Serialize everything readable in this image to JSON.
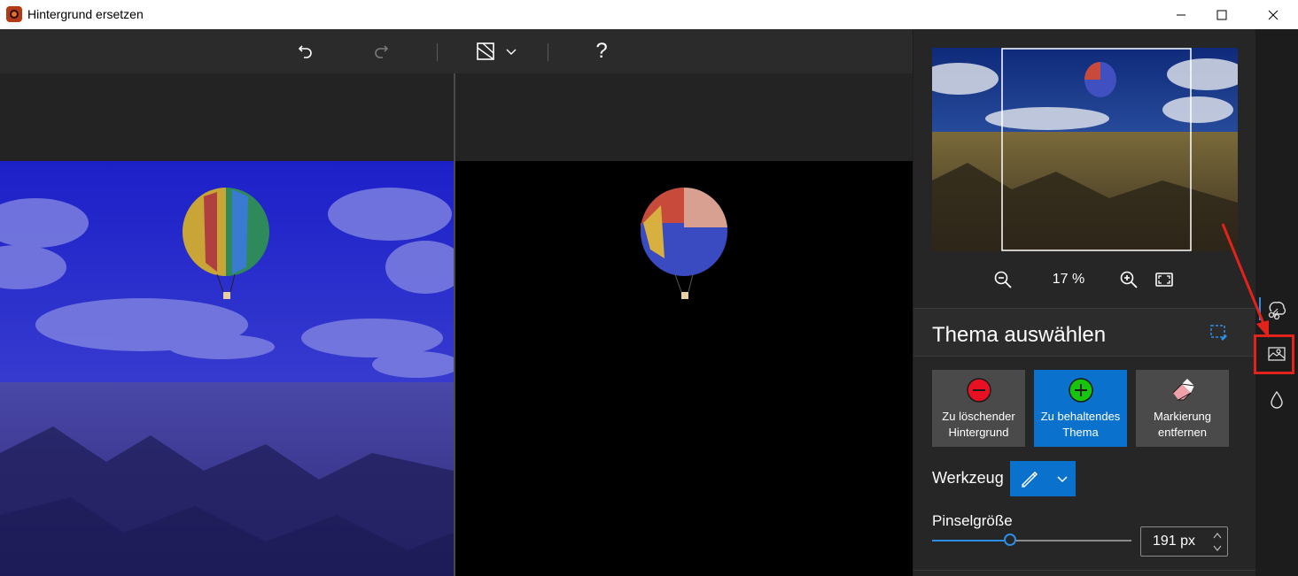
{
  "window": {
    "title": "Hintergrund ersetzen",
    "controls": [
      "minimize-icon",
      "maximize-icon",
      "close-icon"
    ]
  },
  "toolbar": {
    "icons": [
      "undo-icon",
      "redo-icon",
      "image-view-icon",
      "chevron-down-icon",
      "help-icon"
    ],
    "help_label": "?"
  },
  "zoom": {
    "value": "17 %",
    "icons": [
      "zoom-out-icon",
      "zoom-in-icon",
      "fit-to-screen-icon"
    ]
  },
  "panel": {
    "section_title": "Thema auswählen",
    "modes": [
      {
        "label_line1": "Zu löschender",
        "label_line2": "Hintergrund",
        "icon": "minus-circle-icon",
        "color": "#e81123"
      },
      {
        "label_line1": "Zu behaltendes",
        "label_line2": "Thema",
        "icon": "plus-circle-icon",
        "color": "#16c60c",
        "active": true
      },
      {
        "label_line1": "Markierung",
        "label_line2": "entfernen",
        "icon": "eraser-icon"
      }
    ],
    "tool_label": "Werkzeug",
    "tool_icons": [
      "brush-icon",
      "chevron-down-icon"
    ],
    "brush_size_label": "Pinselgröße",
    "brush_size_value": "191 px",
    "brush_size_fraction": 0.39
  },
  "rail": {
    "icons": [
      "cutout-icon",
      "background-replace-icon",
      "drop-icon"
    ],
    "active": "cutout-icon"
  },
  "colors": {
    "accent": "#0a72cc",
    "highlight": "#e3231b"
  }
}
